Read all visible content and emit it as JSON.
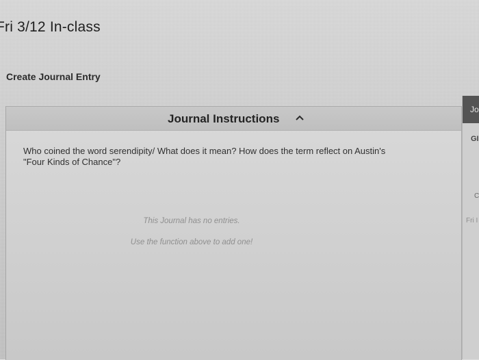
{
  "page": {
    "title": "Fri 3/12 In-class"
  },
  "actions": {
    "create_label": "Create Journal Entry"
  },
  "journal": {
    "instructions_title": "Journal Instructions",
    "prompt_line1": "Who coined the word serendipity/  What does it mean?  How does the term reflect on Austin's",
    "prompt_line2": "\"Four Kinds of Chance\"?",
    "empty_line1": "This Journal has no entries.",
    "empty_line2": "Use the function above to add one!"
  },
  "sidebar": {
    "header": "Jo",
    "subheader": "GI",
    "item1": "Co",
    "item2": "Fri I"
  }
}
